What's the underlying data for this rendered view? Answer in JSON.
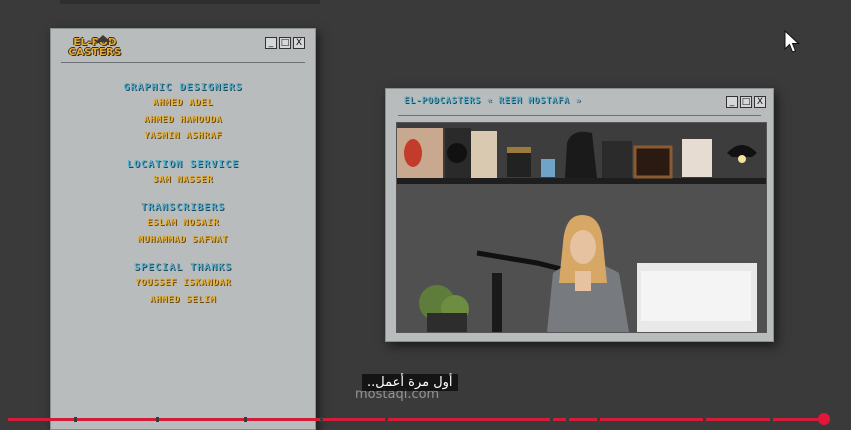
{
  "credits_window": {
    "logo_text_1": "EL-POD",
    "logo_text_2": "CASTERS",
    "controls": [
      "_",
      "□",
      "X"
    ],
    "sections": [
      {
        "title": "GRAPHIC DESIGNERS",
        "names": [
          "AHMED ADEL",
          "AHMED HAMOUDA",
          "YASMIN ASHRAF"
        ]
      },
      {
        "title": "LOCATION SERVICE",
        "names": [
          "3AM NASSER"
        ]
      },
      {
        "title": "TRANSCRIBERS",
        "names": [
          "ESLAM NOSAIR",
          "MUHAMMAD SAFWAT"
        ]
      },
      {
        "title": "SPECIAL THANKS",
        "names": [
          "YOUSSEF ISKANDAR",
          "AHMED SELIM"
        ]
      }
    ]
  },
  "video_window": {
    "title": "EL-PODCASTERS « REEM MOSTAFA »",
    "controls": [
      "_",
      "□",
      "X"
    ]
  },
  "subtitle": "أول مرة أعمل..",
  "watermark": "mostaql.com",
  "player": {
    "progress_percent": 98
  },
  "colors": {
    "background": "#3a3a3a",
    "window": "#b9bcbd",
    "section_title": "#5fb2cd",
    "name": "#e6b13a",
    "progress": "#d21d3a"
  }
}
